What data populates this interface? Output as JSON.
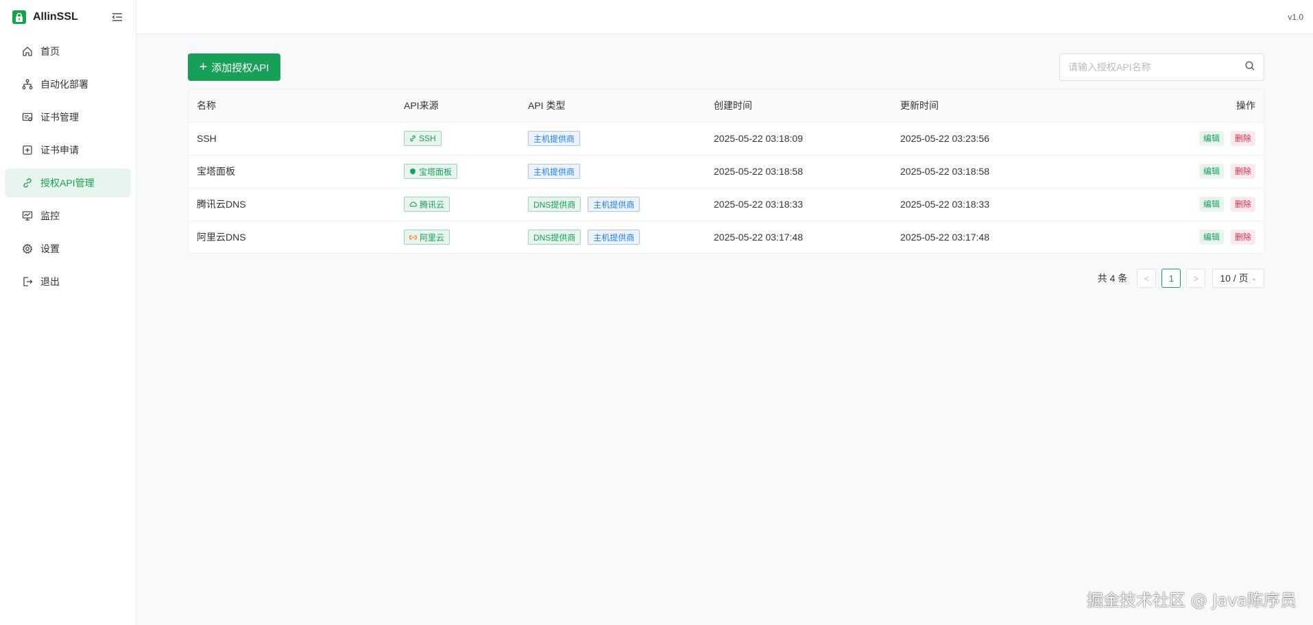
{
  "app": {
    "name": "AllinSSL",
    "version": "v1.0"
  },
  "sidebar": {
    "items": [
      {
        "label": "首页",
        "icon": "home-icon"
      },
      {
        "label": "自动化部署",
        "icon": "workflow-icon"
      },
      {
        "label": "证书管理",
        "icon": "certificate-icon"
      },
      {
        "label": "证书申请",
        "icon": "plus-square-icon"
      },
      {
        "label": "授权API管理",
        "icon": "link-icon",
        "active": true
      },
      {
        "label": "监控",
        "icon": "monitor-icon"
      },
      {
        "label": "设置",
        "icon": "gear-icon"
      },
      {
        "label": "退出",
        "icon": "logout-icon"
      }
    ]
  },
  "toolbar": {
    "add_label": "添加授权API"
  },
  "search": {
    "placeholder": "请输入授权API名称",
    "value": ""
  },
  "table": {
    "headers": {
      "name": "名称",
      "source": "API来源",
      "type": "API 类型",
      "created": "创建时间",
      "updated": "更新时间",
      "ops": "操作"
    },
    "rows": [
      {
        "name": "SSH",
        "source": "SSH",
        "types": [
          "主机提供商"
        ],
        "created": "2025-05-22 03:18:09",
        "updated": "2025-05-22 03:23:56"
      },
      {
        "name": "宝塔面板",
        "source": "宝塔面板",
        "types": [
          "主机提供商"
        ],
        "created": "2025-05-22 03:18:58",
        "updated": "2025-05-22 03:18:58"
      },
      {
        "name": "腾讯云DNS",
        "source": "腾讯云",
        "types": [
          "DNS提供商",
          "主机提供商"
        ],
        "created": "2025-05-22 03:18:33",
        "updated": "2025-05-22 03:18:33"
      },
      {
        "name": "阿里云DNS",
        "source": "阿里云",
        "types": [
          "DNS提供商",
          "主机提供商"
        ],
        "created": "2025-05-22 03:17:48",
        "updated": "2025-05-22 03:17:48"
      }
    ],
    "edit_label": "编辑",
    "delete_label": "删除"
  },
  "pagination": {
    "total": "共 4 条",
    "current_page": "1",
    "page_size": "10 / 页",
    "prev": "<",
    "next": ">"
  },
  "watermark": "掘金技术社区 @ Java陈序员",
  "colors": {
    "primary": "#18a058",
    "danger": "#d03050",
    "info": "#2080f0"
  }
}
